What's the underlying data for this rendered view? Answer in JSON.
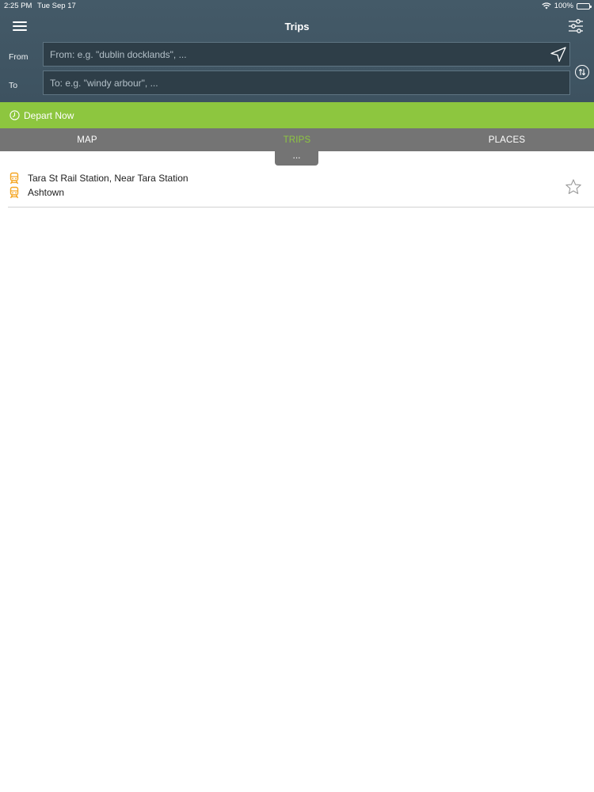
{
  "status_bar": {
    "time": "2:25 PM",
    "date": "Tue Sep 17",
    "battery": "100%",
    "icons": [
      "wifi-icon",
      "battery-icon"
    ]
  },
  "header": {
    "title": "Trips",
    "menu_icon": "hamburger-menu-icon",
    "filter_icon": "filter-sliders-icon",
    "background_color": "#445a68"
  },
  "search": {
    "from_label": "From",
    "from_placeholder": "From: e.g. \"dublin docklands\", ...",
    "from_value": "",
    "to_label": "To",
    "to_placeholder": "To: e.g. \"windy arbour\", ...",
    "to_value": "",
    "locate_icon": "location-arrow-icon",
    "swap_icon": "swap-arrows-icon"
  },
  "depart": {
    "label": "Depart Now",
    "icon": "clock-icon",
    "color": "#8dc63f"
  },
  "tabs": [
    {
      "label": "MAP",
      "active": false
    },
    {
      "label": "TRIPS",
      "active": true
    },
    {
      "label": "PLACES",
      "active": false
    }
  ],
  "tabs_style": {
    "background": "#747474",
    "active_color": "#8dc63f"
  },
  "more_handle": {
    "label": "..."
  },
  "trips": [
    {
      "from": "Tara St Rail Station, Near Tara Station",
      "to": "Ashtown",
      "mode_icon": "train-icon",
      "mode_color": "#f5a623",
      "favorite_icon": "star-outline-icon"
    }
  ]
}
